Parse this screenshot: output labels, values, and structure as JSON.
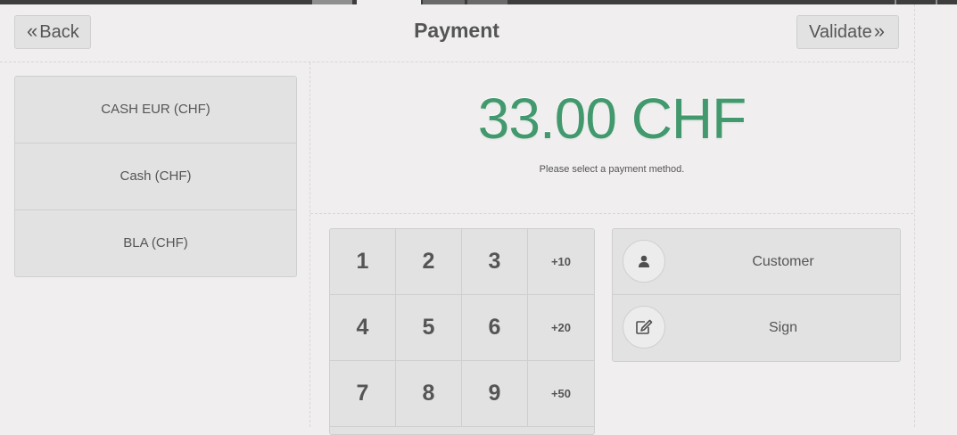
{
  "header": {
    "back_label": "Back",
    "title": "Payment",
    "validate_label": "Validate"
  },
  "payment_methods": [
    {
      "label": "CASH EUR (CHF)"
    },
    {
      "label": "Cash (CHF)"
    },
    {
      "label": "BLA (CHF)"
    }
  ],
  "summary": {
    "amount_due": "33.00 CHF",
    "message": "Please select a payment method."
  },
  "numpad": {
    "keys": [
      "1",
      "2",
      "3",
      "+10",
      "4",
      "5",
      "6",
      "+20",
      "7",
      "8",
      "9",
      "+50"
    ]
  },
  "actions": {
    "customer_label": "Customer",
    "sign_label": "Sign"
  },
  "colors": {
    "accent_amount": "#43996e",
    "background": "#f0eeee",
    "button": "#e2e2e2"
  },
  "icons": {
    "back": "double-chevron-left-icon",
    "validate": "double-chevron-right-icon",
    "customer": "user-icon",
    "sign": "edit-icon"
  }
}
